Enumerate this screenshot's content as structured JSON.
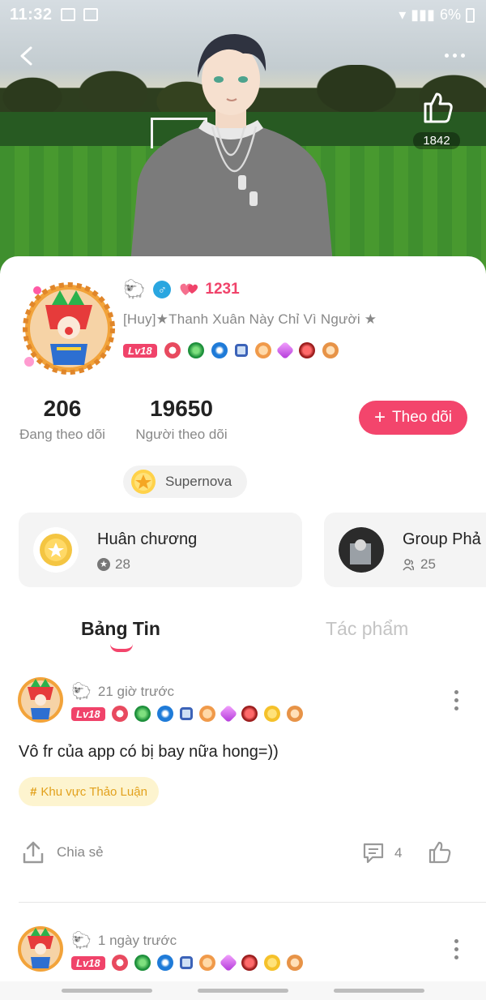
{
  "status_bar": {
    "time": "11:32",
    "battery": "6%"
  },
  "header": {
    "like_count": "1842"
  },
  "profile": {
    "love_count": "1231",
    "display_name": "[Huy]★Thanh Xuân Này Chỉ Vì Người ★",
    "level": "Lv18",
    "gender_symbol": "♂",
    "following_count": "206",
    "following_label": "Đang theo dõi",
    "followers_count": "19650",
    "followers_label": "Người theo dõi",
    "follow_button_label": "Theo dõi",
    "tier_label": "Supernova"
  },
  "info_cards": [
    {
      "title": "Huân chương",
      "count": "28"
    },
    {
      "title": "Group Phả",
      "count": "25"
    }
  ],
  "tabs": [
    {
      "label": "Bảng Tin",
      "active": true
    },
    {
      "label": "Tác phẩm",
      "active": false
    }
  ],
  "posts": [
    {
      "time": "21 giờ trước",
      "level": "Lv18",
      "text": "Vô fr của app có bị bay nữa hong=))",
      "tag": "Khu vực Thảo Luận",
      "share_label": "Chia sẻ",
      "comment_count": "4"
    },
    {
      "time": "1 ngày trước",
      "level": "Lv18"
    }
  ],
  "colors": {
    "accent": "#f3456c",
    "tag_bg": "#fdf4cf",
    "tag_text": "#e2a11c"
  }
}
